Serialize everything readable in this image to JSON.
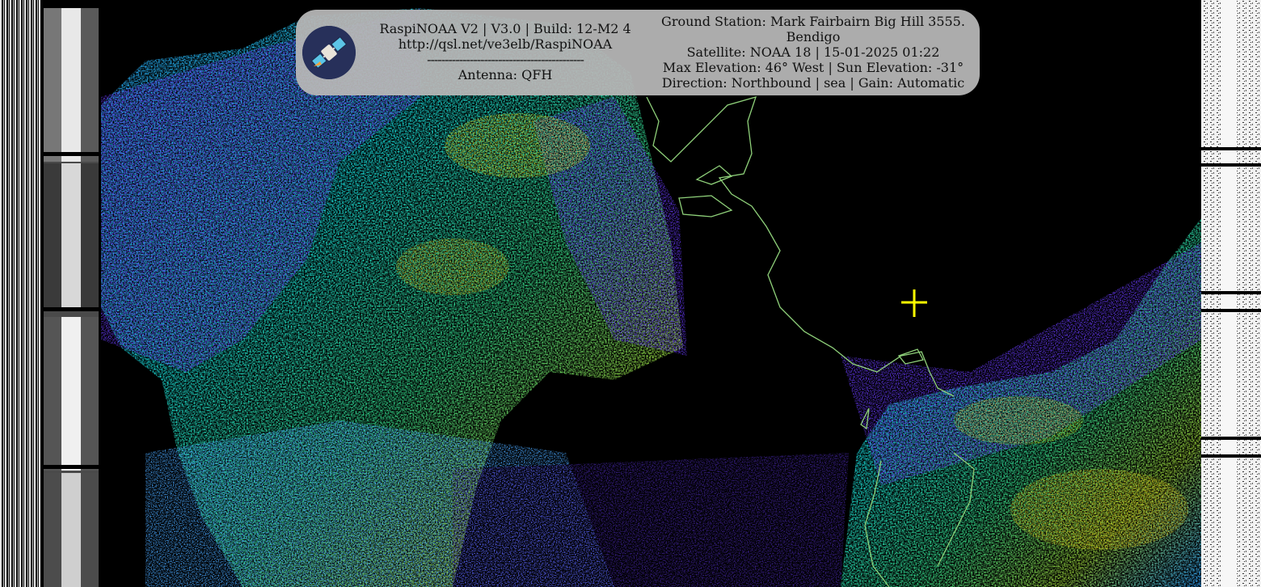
{
  "header": {
    "app_line": "RaspiNOAA V2 | V3.0 | Build: 12-M2 4",
    "url_line": "http://qsl.net/ve3elb/RaspiNOAA",
    "separator": "--------------------------------------------",
    "antenna_line": "Antenna: QFH",
    "ground_station_line": "Ground Station: Mark Fairbairn Big Hill 3555.",
    "location_line": "Bendigo",
    "satellite_line": "Satellite: NOAA 18 | 15-01-2025 01:22",
    "elevation_line": "Max Elevation: 46° West | Sun Elevation: -31°",
    "direction_line": "Direction: Northbound | sea | Gain: Automatic"
  },
  "icons": {
    "logo": "satellite-icon",
    "marker": "crosshair-icon"
  },
  "colors": {
    "background": "#000000",
    "coastline": "#8fd17a",
    "crosshair": "#ffff00",
    "overlay": "#b7b7b7",
    "logo_bg": "#27305a"
  }
}
